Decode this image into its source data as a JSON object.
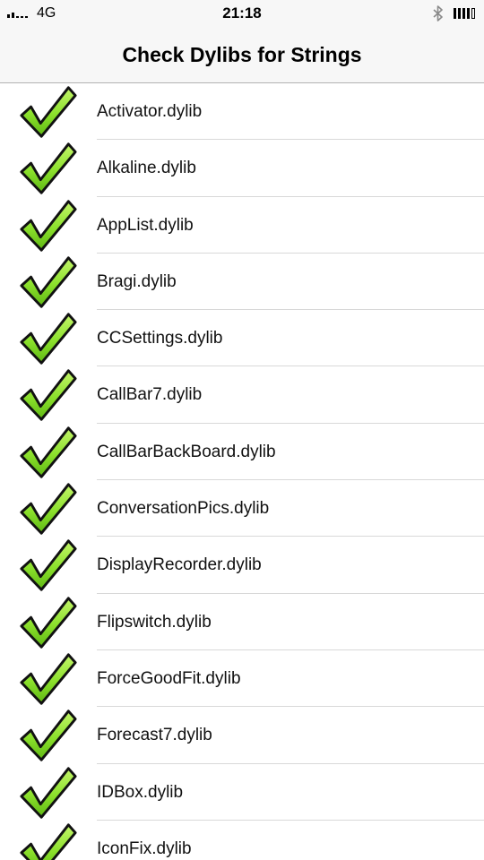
{
  "status_bar": {
    "carrier": "4G",
    "time": "21:18",
    "icons": [
      "signal-icon",
      "bluetooth-icon",
      "battery-icon"
    ]
  },
  "nav": {
    "title": "Check Dylibs for Strings"
  },
  "colors": {
    "check_fill": "#8be02c",
    "check_stroke": "#111111",
    "separator": "#d8d8d8",
    "bar_background": "#f7f7f7"
  },
  "items": [
    {
      "label": "Activator.dylib",
      "icon": "checkmark-icon"
    },
    {
      "label": "Alkaline.dylib",
      "icon": "checkmark-icon"
    },
    {
      "label": "AppList.dylib",
      "icon": "checkmark-icon"
    },
    {
      "label": "Bragi.dylib",
      "icon": "checkmark-icon"
    },
    {
      "label": "CCSettings.dylib",
      "icon": "checkmark-icon"
    },
    {
      "label": "CallBar7.dylib",
      "icon": "checkmark-icon"
    },
    {
      "label": "CallBarBackBoard.dylib",
      "icon": "checkmark-icon"
    },
    {
      "label": "ConversationPics.dylib",
      "icon": "checkmark-icon"
    },
    {
      "label": "DisplayRecorder.dylib",
      "icon": "checkmark-icon"
    },
    {
      "label": "Flipswitch.dylib",
      "icon": "checkmark-icon"
    },
    {
      "label": "ForceGoodFit.dylib",
      "icon": "checkmark-icon"
    },
    {
      "label": "Forecast7.dylib",
      "icon": "checkmark-icon"
    },
    {
      "label": "IDBox.dylib",
      "icon": "checkmark-icon"
    },
    {
      "label": "IconFix.dylib",
      "icon": "checkmark-icon"
    }
  ]
}
